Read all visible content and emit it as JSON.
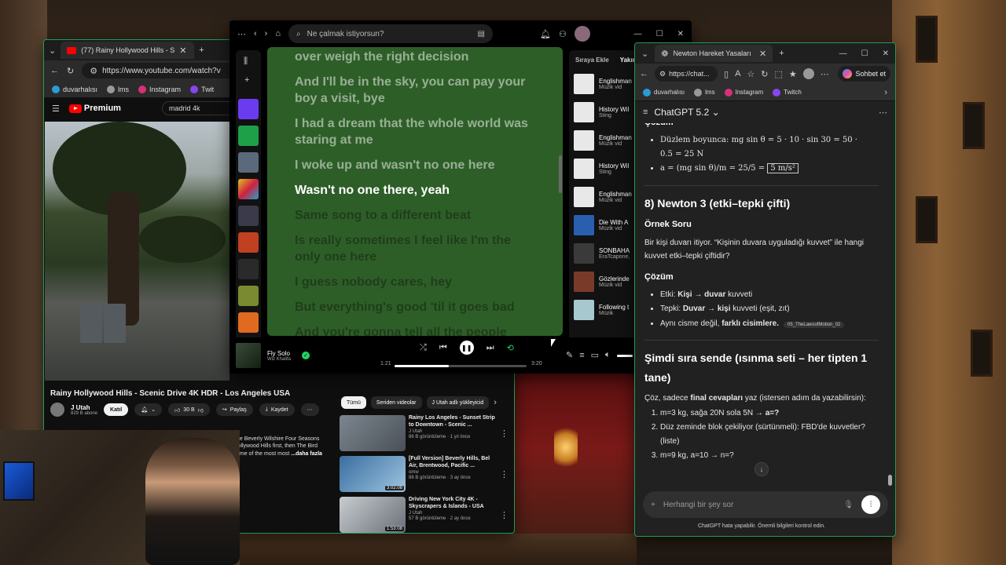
{
  "youtube": {
    "tab_title": "(77) Rainy Hollywood Hills - S",
    "url": "https://www.youtube.com/watch?v",
    "bookmarks": [
      "duvarhalısı",
      "lms",
      "Instagram",
      "Twit"
    ],
    "logo_text": "Premium",
    "search_value": "madrid 4k",
    "video_title": "Rainy Hollywood Hills - Scenic Drive 4K HDR - Los Angeles USA",
    "channel_name": "J Utah",
    "channel_subs": "829 B abone",
    "join_label": "Katıl",
    "likes": "30 B",
    "share_label": "Paylaş",
    "save_label": "Kaydet",
    "chips": [
      "Tümü",
      "Seriden videolar",
      "J Utah adlı yükleyicid"
    ],
    "description": [
      "he Beverly Wilshire Four Seasons",
      "lollywood Hills first, then The Bird",
      "ome of the most most",
      "...daha fazla"
    ],
    "recommendations": [
      {
        "title": "Rainy Los Angeles - Sunset Strip to Downtown - Scenic ...",
        "channel": "J Utah",
        "meta": "86 B görüntüleme · 1 yıl önce",
        "duration": ""
      },
      {
        "title": "[Full Version] Beverly Hills, Bel Air, Brentwood, Pacific ...",
        "channel": "omw",
        "meta": "88 B görüntüleme · 3 ay önce",
        "duration": "3:02:08"
      },
      {
        "title": "Driving New York City 4K - Skyscrapers & Islands - USA",
        "channel": "J Utah",
        "meta": "57 B görüntüleme · 2 ay önce",
        "duration": "1:53:08"
      }
    ]
  },
  "spotify": {
    "search_placeholder": "Ne çalmak istiyorsun?",
    "lyrics": [
      {
        "text": "over weigh the right decision",
        "state": "done"
      },
      {
        "text": "And I'll be in the sky, you can pay your boy a visit, bye",
        "state": "done"
      },
      {
        "text": "I had a dream that the whole world was staring at me",
        "state": "done"
      },
      {
        "text": "I woke up and wasn't no one here",
        "state": "done"
      },
      {
        "text": "Wasn't no one there, yeah",
        "state": "active"
      },
      {
        "text": "Same song to a different beat",
        "state": "upcoming"
      },
      {
        "text": "Is really sometimes I feel like I'm the only one here",
        "state": "upcoming"
      },
      {
        "text": "I guess nobody cares, hey",
        "state": "upcoming"
      },
      {
        "text": "But everything's good 'til it goes bad",
        "state": "upcoming"
      },
      {
        "text": "And you're gonna tell all the people",
        "state": "upcoming"
      }
    ],
    "queue_tabs": [
      "Sıraya Ekle",
      "Yakın"
    ],
    "queue": [
      {
        "title": "Englishman",
        "artist": "Müzik vid",
        "color": "#e8e8e8"
      },
      {
        "title": "History Wil",
        "artist": "Sting",
        "color": "#e8e8e8"
      },
      {
        "title": "Englishman",
        "artist": "Müzik vid",
        "color": "#e8e8e8"
      },
      {
        "title": "History Wil",
        "artist": "Sting",
        "color": "#e8e8e8"
      },
      {
        "title": "Englishman",
        "artist": "Müzik vid",
        "color": "#e8e8e8"
      },
      {
        "title": "Die With A",
        "artist": "Müzik vid",
        "color": "#2a5fb0"
      },
      {
        "title": "SONBAHA",
        "artist": "EraTcapone,",
        "color": "#3a3a3a"
      },
      {
        "title": "Gözlerinde",
        "artist": "Müzik vid",
        "color": "#7a3a2a"
      },
      {
        "title": "Following t",
        "artist": "Müzik",
        "color": "#a8c8d0"
      }
    ],
    "now_playing": {
      "title": "Fly Solo",
      "artist": "Wiz Khalifa",
      "elapsed": "1:21",
      "total": "3:20",
      "progress": 0.41
    }
  },
  "chatgpt": {
    "tab_title": "Newton Hareket Yasaları",
    "url": "https://chat...",
    "copilot_label": "Sohbet et",
    "bookmarks": [
      "duvarhalısı",
      "lms",
      "Instagram",
      "Twitch"
    ],
    "model": "ChatGPT 5.2",
    "cozum_label": "Çözüm",
    "bullet1a": "Düzlem boyunca: mg sin θ = 5 · 10 · sin 30 = 50 ·",
    "bullet1b": "0.5 = 25 N",
    "bullet2": "a = (mg sin θ)/m = 25/5 = ",
    "bullet2_box": "5 m/s²",
    "section8": "8) Newton 3 (etki–tepki çifti)",
    "ornek_label": "Örnek Soru",
    "ornek_text": "Bir kişi duvarı itiyor. “Kişinin duvara uyguladığı kuvvet” ile hangi kuvvet etki–tepki çiftidir?",
    "cozum2_label": "Çözüm",
    "etki_label": "Etki:",
    "etki_a": "Kişi",
    "etki_b": "duvar",
    "etki_suffix": "kuvveti",
    "tepki_label": "Tepki:",
    "tepki_a": "Duvar",
    "tepki_b": "kişi",
    "tepki_suffix": "kuvveti (eşit, zıt)",
    "ayni_prefix": "Aynı cisme değil,",
    "ayni_bold": "farklı cisimlere.",
    "cite": "05_TheLawsofMotion_02",
    "section_now": "Şimdi sıra sende (ısınma seti – her tipten 1 tane)",
    "now_intro_a": "Çöz, sadece",
    "now_intro_b": "final cevapları",
    "now_intro_c": "yaz (istersen adım da yazabilirsin):",
    "q1_a": "m=3 kg, sağa 20N sola 5N →",
    "q1_b": "a=?",
    "q2": "Düz zeminde blok çekiliyor (sürtünmeli): FBD'de kuvvetler? (liste)",
    "q3": "m=9 kg, a=10 → n=?",
    "input_placeholder": "Herhangi bir şey sor",
    "footer": "ChatGPT hata yapabilir. Önemli bilgileri kontrol edin."
  }
}
